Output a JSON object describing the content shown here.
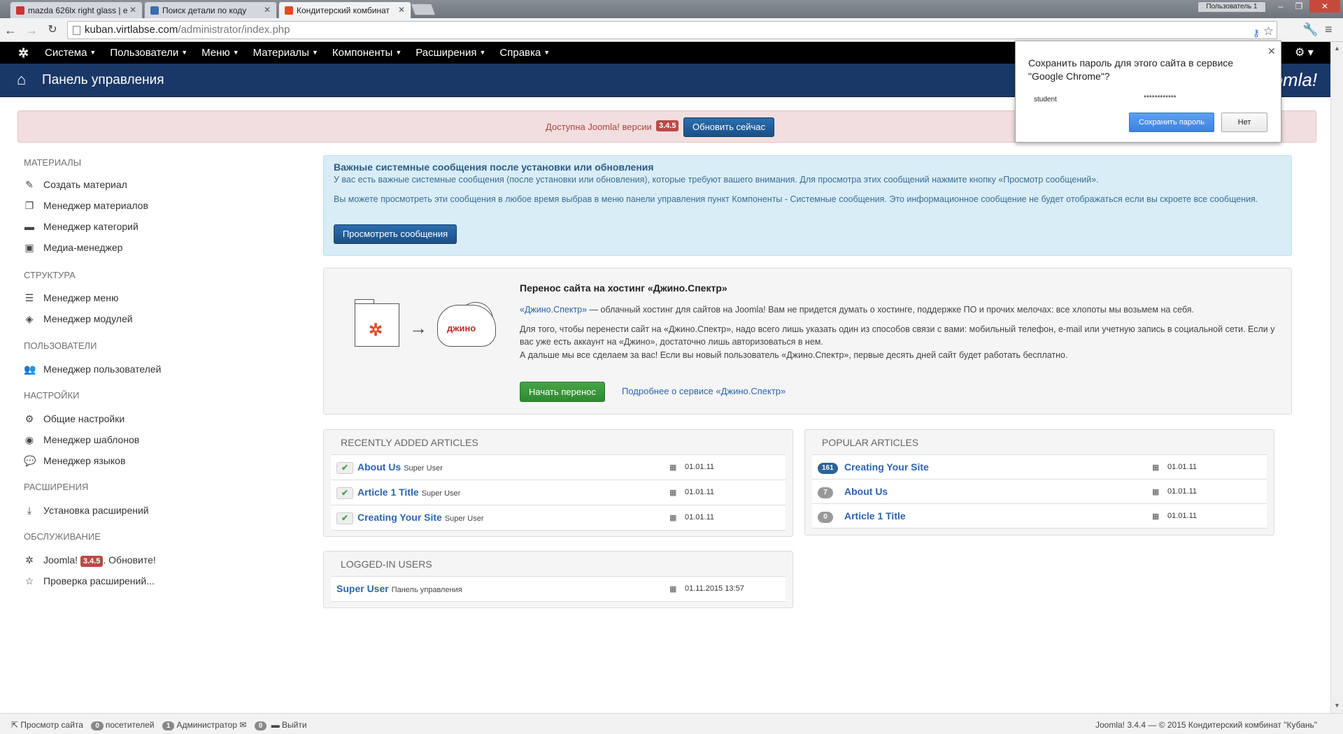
{
  "browser": {
    "tabs": [
      {
        "label": "mazda 626lx right glass | e"
      },
      {
        "label": "Поиск детали по коду"
      },
      {
        "label": "Кондитерский комбинат"
      }
    ],
    "user_button": "Пользователь 1",
    "url_host": "kuban.virtlabse.com",
    "url_path": "/administrator/index.php"
  },
  "password_popup": {
    "question": "Сохранить пароль для этого сайта в сервисе \"Google Chrome\"?",
    "username": "student",
    "password_mask": "************",
    "save_label": "Сохранить пароль",
    "no_label": "Нет"
  },
  "joomla": {
    "menu": [
      {
        "label": "Система"
      },
      {
        "label": "Пользователи"
      },
      {
        "label": "Меню"
      },
      {
        "label": "Материалы"
      },
      {
        "label": "Компоненты"
      },
      {
        "label": "Расширения"
      },
      {
        "label": "Справка"
      }
    ],
    "header_title": "Панель управления",
    "brand": "Joomla!"
  },
  "update_bar": {
    "text": "Доступна Joomla! версии",
    "version": "3.4.5",
    "button": "Обновить сейчас"
  },
  "sidebar": {
    "groups": [
      {
        "heading": "МАТЕРИАЛЫ",
        "items": [
          {
            "label": "Создать материал"
          },
          {
            "label": "Менеджер материалов"
          },
          {
            "label": "Менеджер категорий"
          },
          {
            "label": "Медиа-менеджер"
          }
        ]
      },
      {
        "heading": "СТРУКТУРА",
        "items": [
          {
            "label": "Менеджер меню"
          },
          {
            "label": "Менеджер модулей"
          }
        ]
      },
      {
        "heading": "ПОЛЬЗОВАТЕЛИ",
        "items": [
          {
            "label": "Менеджер пользователей"
          }
        ]
      },
      {
        "heading": "НАСТРОЙКИ",
        "items": [
          {
            "label": "Общие настройки"
          },
          {
            "label": "Менеджер шаблонов"
          },
          {
            "label": "Менеджер языков"
          }
        ]
      },
      {
        "heading": "РАСШИРЕНИЯ",
        "items": [
          {
            "label": "Установка расширений"
          }
        ]
      },
      {
        "heading": "ОБСЛУЖИВАНИЕ",
        "items": [
          {
            "label": "Joomla!"
          },
          {
            "label": "Проверка расширений..."
          }
        ]
      }
    ],
    "joomla_update_version": "3.4.5",
    "joomla_update_text": ". Обновите!"
  },
  "messages": {
    "heading": "Важные системные сообщения после установки или обновления",
    "p1": "У вас есть важные системные сообщения (после установки или обновления), которые требуют вашего внимания. Для просмотра этих сообщений нажмите кнопку «Просмотр сообщений».",
    "p2": "Вы можете просмотреть эти сообщения в любое время выбрав в меню панели управления пункт Компоненты - Системные сообщения. Это информационное сообщение не будет отображаться если вы скроете все сообщения.",
    "button": "Просмотреть сообщения"
  },
  "jino": {
    "heading": "Перенос сайта на хостинг «Джино.Спектр»",
    "p1_link": "«Джино.Спектр»",
    "p1_rest": " — облачный хостинг для сайтов на Joomla! Вам не придется думать о хостинге, поддержке ПО и прочих мелочах: все хлопоты мы возьмем на себя.",
    "p2": "Для того, чтобы перенести сайт на «Джино.Спектр», надо всего лишь указать один из способов связи с вами: мобильный телефон, e-mail или учетную запись в социальной сети. Если у вас уже есть аккаунт на «Джино», достаточно лишь авторизоваться в нем.",
    "p3": "А дальше мы все сделаем за вас! Если вы новый пользователь «Джино.Спектр», первые десять дней сайт будет работать бесплатно.",
    "cloud_text": "джино",
    "button": "Начать перенос",
    "more_link": "Подробнее о сервисе «Джино.Спектр»"
  },
  "recent": {
    "heading": "RECENTLY ADDED ARTICLES",
    "rows": [
      {
        "title": "About Us",
        "author": "Super User",
        "date": "01.01.11"
      },
      {
        "title": "Article 1 Title",
        "author": "Super User",
        "date": "01.01.11"
      },
      {
        "title": "Creating Your Site",
        "author": "Super User",
        "date": "01.01.11"
      }
    ]
  },
  "popular": {
    "heading": "POPULAR ARTICLES",
    "rows": [
      {
        "hits": "161",
        "title": "Creating Your Site",
        "date": "01.01.11"
      },
      {
        "hits": "7",
        "title": "About Us",
        "date": "01.01.11"
      },
      {
        "hits": "0",
        "title": "Article 1 Title",
        "date": "01.01.11"
      }
    ]
  },
  "logged": {
    "heading": "LOGGED-IN USERS",
    "rows": [
      {
        "user": "Super User",
        "where": "Панель управления",
        "date": "01.11.2015 13:57"
      }
    ]
  },
  "status": {
    "view_site": "Просмотр сайта",
    "visitors_count": "0",
    "visitors_label": "посетителей",
    "admins_count": "1",
    "admins_label": "Администратор",
    "messages_count": "0",
    "logout": "Выйти",
    "copyright": "Joomla! 3.4.4  —  © 2015 Кондитерский комбинат \"Кубань\""
  }
}
